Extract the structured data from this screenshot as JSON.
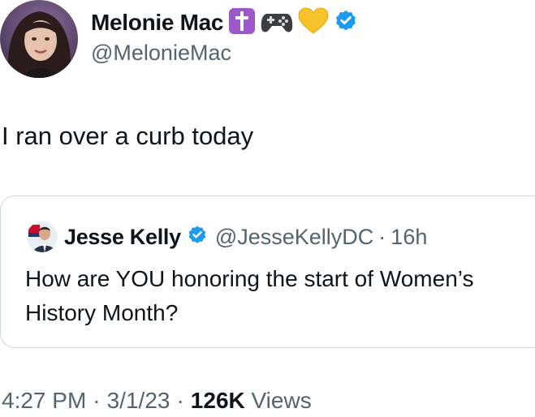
{
  "author": {
    "display_name": "Melonie Mac",
    "handle": "@MelonieMac",
    "emoji_icons": [
      "latin-cross-icon",
      "game-controller-icon",
      "yellow-heart-icon"
    ],
    "verified": true
  },
  "tweet": {
    "text": "I ran over a curb today"
  },
  "quoted_tweet": {
    "display_name": "Jesse Kelly",
    "handle": "@JesseKellyDC",
    "separator": "·",
    "time": "16h",
    "verified": true,
    "text_line1": "How are YOU honoring the start of Women’s",
    "text_line2": "History Month?"
  },
  "meta": {
    "time": "4:27 PM",
    "separator": "·",
    "date": "3/1/23",
    "views_count": "126K",
    "views_label": "Views"
  },
  "colors": {
    "text_primary": "#0f1419",
    "text_secondary": "#536471",
    "verified_blue": "#1d9bf0",
    "card_border": "#cfd9de"
  }
}
